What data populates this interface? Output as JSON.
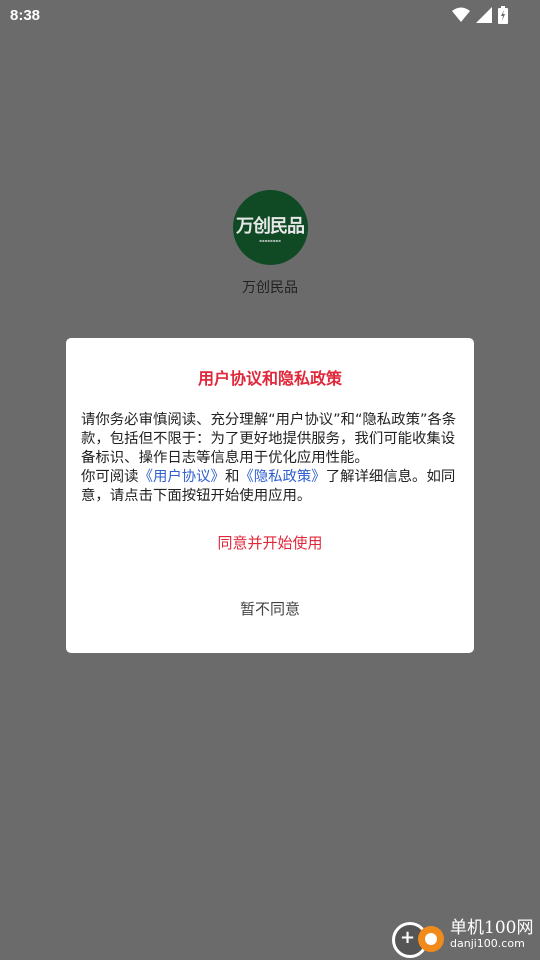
{
  "status_bar": {
    "time": "8:38",
    "icons": [
      "wifi-icon",
      "signal-icon",
      "battery-icon"
    ]
  },
  "app": {
    "logo_text": "万创民品",
    "name": "万创民品",
    "logo_color": "#0f4a25"
  },
  "dialog": {
    "title": "用户协议和隐私政策",
    "body_part1": "请你务必审慎阅读、充分理解“用户协议”和“隐私政策”各条款，包括但不限于：为了更好地提供服务，我们可能收集设备标识、操作日志等信息用于优化应用性能。",
    "body_part2_prefix": "你可阅读",
    "user_agreement_link": "《用户协议》",
    "and_text": "和",
    "privacy_policy_link": "《隐私政策》",
    "body_part2_suffix": "了解详细信息。如同意，请点击下面按钮开始使用应用。",
    "agree_button": "同意并开始使用",
    "disagree_button": "暂不同意",
    "accent_color": "#e0283b",
    "link_color": "#2f5fd0"
  },
  "watermark": {
    "cn": "单机100网",
    "en": "danji100.com"
  }
}
